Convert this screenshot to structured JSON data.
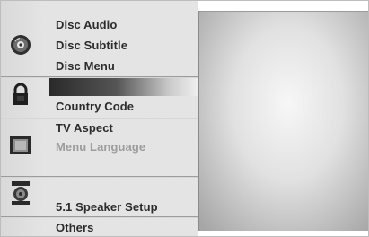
{
  "menu": {
    "disc_group": {
      "icon": "disc-icon",
      "items": [
        "Disc Audio",
        "Disc Subtitle",
        "Disc Menu"
      ]
    },
    "lock_group": {
      "icon": "lock-icon",
      "selected_item": "",
      "items": [
        "Country Code"
      ]
    },
    "display_group": {
      "icon": "screen-icon",
      "items": [
        "TV Aspect",
        "Menu Language"
      ]
    },
    "audio_group": {
      "icon": "speaker-icon",
      "items": [
        "5.1 Speaker Setup"
      ]
    },
    "others_group": {
      "items": [
        "Others"
      ]
    }
  },
  "colors": {
    "panel": "#e4e4e4",
    "text": "#2c2c2c",
    "dim_text": "#9c9c9c",
    "highlight_start": "#2a2a2a"
  }
}
